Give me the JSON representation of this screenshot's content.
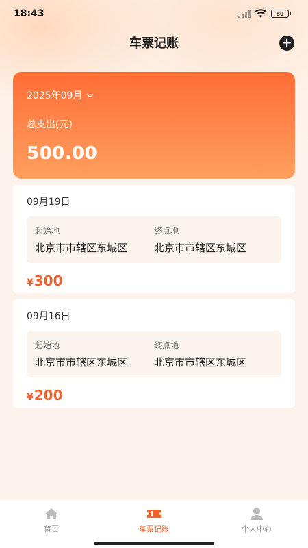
{
  "status_bar": {
    "time": "18:43",
    "battery": "80"
  },
  "header": {
    "title": "车票记账",
    "add_icon": "plus-circle-icon"
  },
  "summary": {
    "month": "2025年09月",
    "label": "总支出(元)",
    "amount": "500.00"
  },
  "records": [
    {
      "date": "09月19日",
      "origin_label": "起始地",
      "origin": "北京市市辖区东城区",
      "dest_label": "终点地",
      "dest": "北京市市辖区东城区",
      "currency": "¥",
      "amount": "300"
    },
    {
      "date": "09月16日",
      "origin_label": "起始地",
      "origin": "北京市市辖区东城区",
      "dest_label": "终点地",
      "dest": "北京市市辖区东城区",
      "currency": "¥",
      "amount": "200"
    }
  ],
  "tabs": [
    {
      "label": "首页",
      "icon": "home-icon",
      "active": false
    },
    {
      "label": "车票记账",
      "icon": "ticket-icon",
      "active": true
    },
    {
      "label": "个人中心",
      "icon": "user-icon",
      "active": false
    }
  ],
  "colors": {
    "accent": "#f0612e",
    "card_gradient_top": "#ff6d36",
    "card_gradient_bottom": "#ff9f5f",
    "background": "#fdf3ec"
  }
}
